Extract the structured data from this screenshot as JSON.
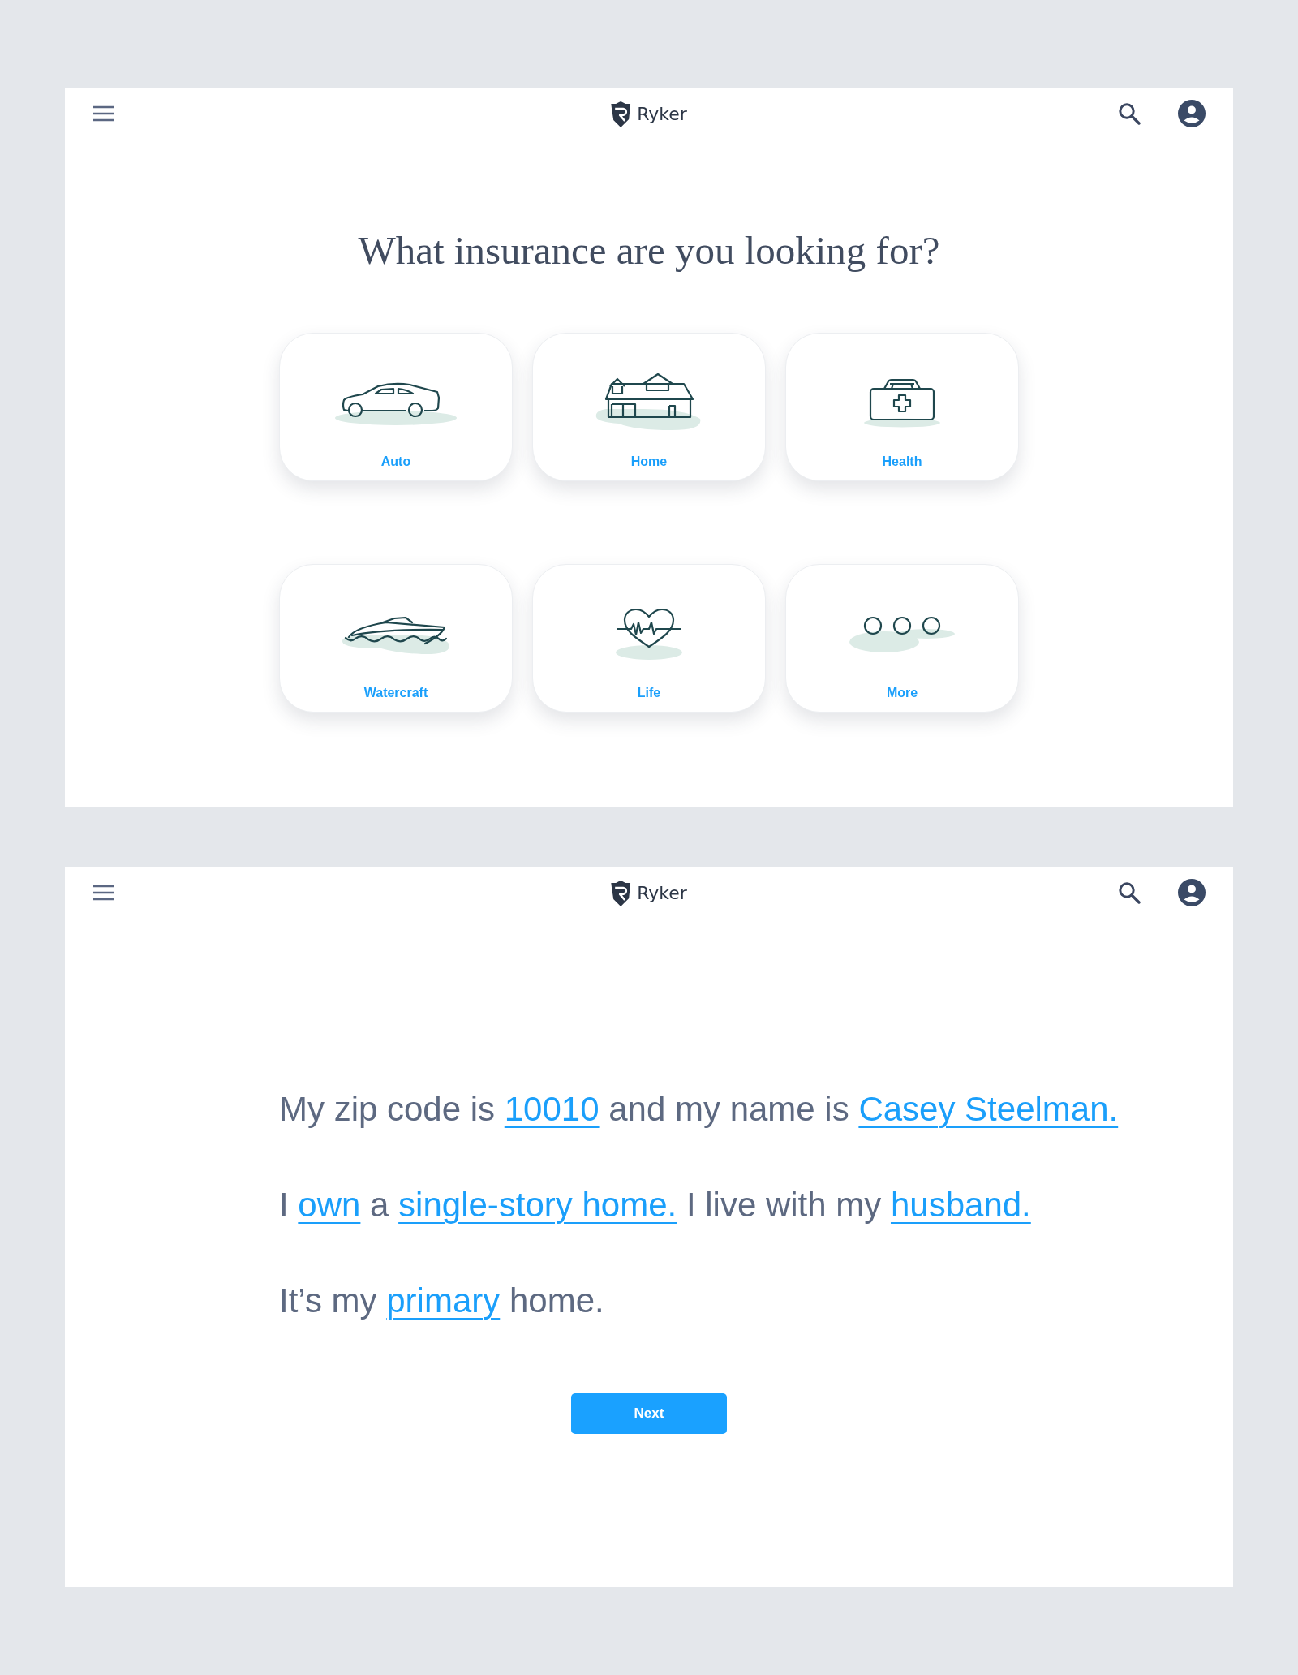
{
  "insurance_screen": {
    "header": {
      "brand": "Ryker"
    },
    "title": "What insurance are you looking for?",
    "options": [
      {
        "label": "Auto",
        "kind": "car"
      },
      {
        "label": "Home",
        "kind": "house"
      },
      {
        "label": "Health",
        "kind": "kit"
      },
      {
        "label": "Watercraft",
        "kind": "boat"
      },
      {
        "label": "Life",
        "kind": "heart"
      },
      {
        "label": "More",
        "kind": "dots"
      }
    ]
  },
  "details_screen": {
    "header": {
      "brand": "Ryker"
    },
    "sentences": [
      {
        "parts": [
          {
            "kind": "text",
            "text": "My zip code is"
          },
          {
            "kind": "link",
            "text": "10010"
          },
          {
            "kind": "text",
            "text": "and my name is"
          },
          {
            "kind": "link",
            "text": "Casey Steelman."
          }
        ]
      },
      {
        "parts": [
          {
            "kind": "text",
            "text": "I"
          },
          {
            "kind": "link",
            "text": "own"
          },
          {
            "kind": "text",
            "text": "a"
          },
          {
            "kind": "link",
            "text": "single-story home."
          },
          {
            "kind": "text",
            "text": "I live with my"
          },
          {
            "kind": "link",
            "text": "husband."
          }
        ]
      },
      {
        "parts": [
          {
            "kind": "text",
            "text": "It’s my"
          },
          {
            "kind": "link",
            "text": "primary"
          },
          {
            "kind": "text",
            "text": "home."
          }
        ]
      }
    ],
    "button": "Next"
  }
}
